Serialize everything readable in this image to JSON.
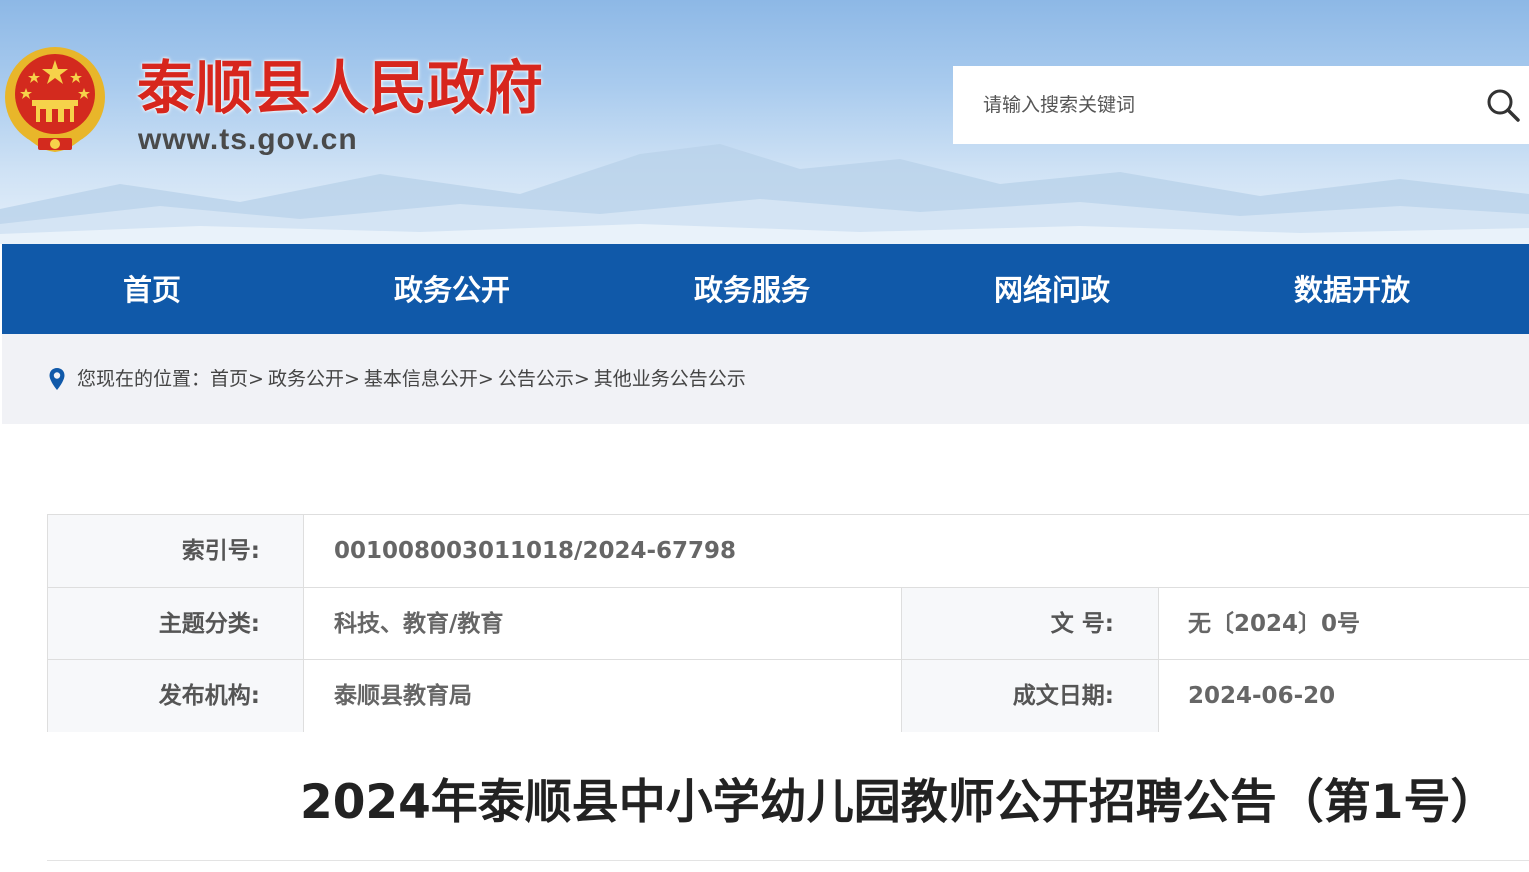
{
  "header": {
    "site_title": "泰顺县人民政府",
    "site_url": "www.ts.gov.cn",
    "emblem_icon": "national-emblem-icon",
    "search": {
      "placeholder": "请输入搜索关键词",
      "value": "",
      "icon": "search-icon"
    }
  },
  "nav": {
    "items": [
      {
        "label": "首页"
      },
      {
        "label": "政务公开"
      },
      {
        "label": "政务服务"
      },
      {
        "label": "网络问政"
      },
      {
        "label": "数据开放"
      }
    ]
  },
  "breadcrumb": {
    "icon": "location-pin-icon",
    "prefix": "您现在的位置：",
    "items": [
      {
        "label": "首页"
      },
      {
        "label": "政务公开"
      },
      {
        "label": "基本信息公开"
      },
      {
        "label": "公告公示"
      },
      {
        "label": "其他业务公告公示"
      }
    ],
    "separator": ">"
  },
  "info_table": {
    "index_label": "索引号:",
    "index_value": "001008003011018/2024-67798",
    "topic_label": "主题分类:",
    "topic_value": "科技、教育/教育",
    "doc_no_label": "文  号:",
    "doc_no_value": "无〔2024〕0号",
    "publisher_label": "发布机构:",
    "publisher_value": "泰顺县教育局",
    "date_label": "成文日期:",
    "date_value": "2024-06-20"
  },
  "article": {
    "title": "2024年泰顺县中小学幼儿园教师公开招聘公告（第1号）"
  },
  "colors": {
    "nav_bg": "#1059a9",
    "title_red": "#d7261d",
    "crumb_bg": "#f1f2f6",
    "pin_blue": "#1059a9"
  }
}
